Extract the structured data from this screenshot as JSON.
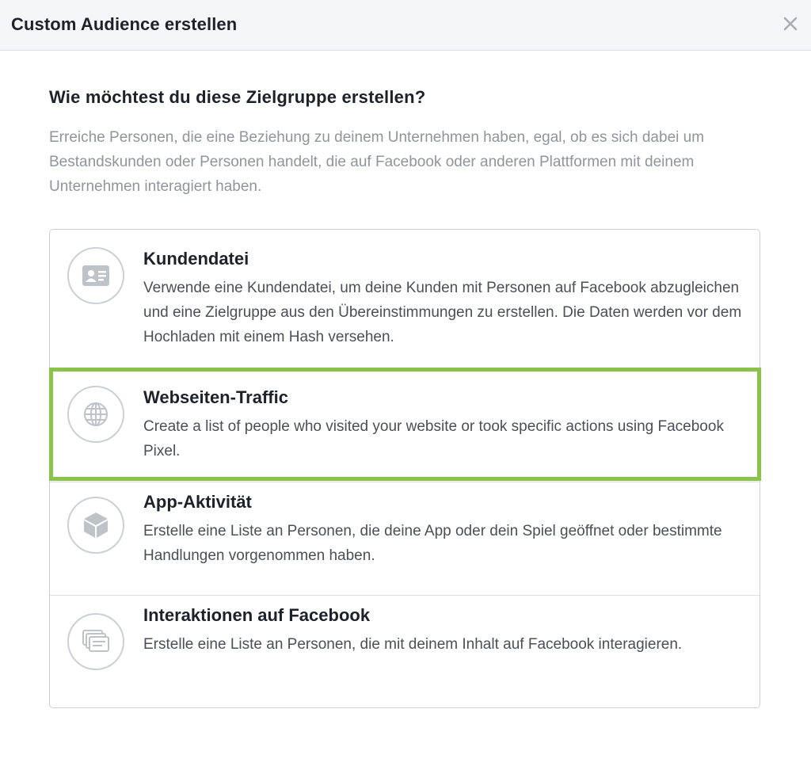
{
  "dialog": {
    "title": "Custom Audience erstellen",
    "close_icon": "close-icon"
  },
  "main": {
    "question": "Wie möchtest du diese Zielgruppe erstellen?",
    "description": "Erreiche Personen, die eine Beziehung zu deinem Unternehmen haben, egal, ob es sich dabei um Bestandskunden oder Personen handelt, die auf Facebook oder anderen Plattformen mit deinem Unternehmen interagiert haben."
  },
  "options": [
    {
      "title": "Kundendatei",
      "description": "Verwende eine Kundendatei, um deine Kunden mit Personen auf Facebook abzugleichen und eine Zielgruppe aus den Übereinstimmungen zu erstellen. Die Daten werden vor dem Hochladen mit einem Hash versehen.",
      "icon": "contact-card-icon"
    },
    {
      "title": "Webseiten-Traffic",
      "description": "Create a list of people who visited your website or took specific actions using Facebook Pixel.",
      "icon": "globe-icon",
      "highlighted": true
    },
    {
      "title": "App-Aktivität",
      "description": "Erstelle eine Liste an Personen, die deine App oder dein Spiel geöffnet oder bestimmte Handlungen vorgenommen haben.",
      "icon": "cube-icon"
    },
    {
      "title": "Interaktionen auf Facebook",
      "description": "Erstelle eine Liste an Personen, die mit deinem Inhalt auf Facebook interagieren.",
      "icon": "stacked-cards-icon"
    }
  ],
  "colors": {
    "highlight": "#8bc34a",
    "header_bg": "#f5f6f7",
    "icon_gray": "#bec2c9"
  }
}
